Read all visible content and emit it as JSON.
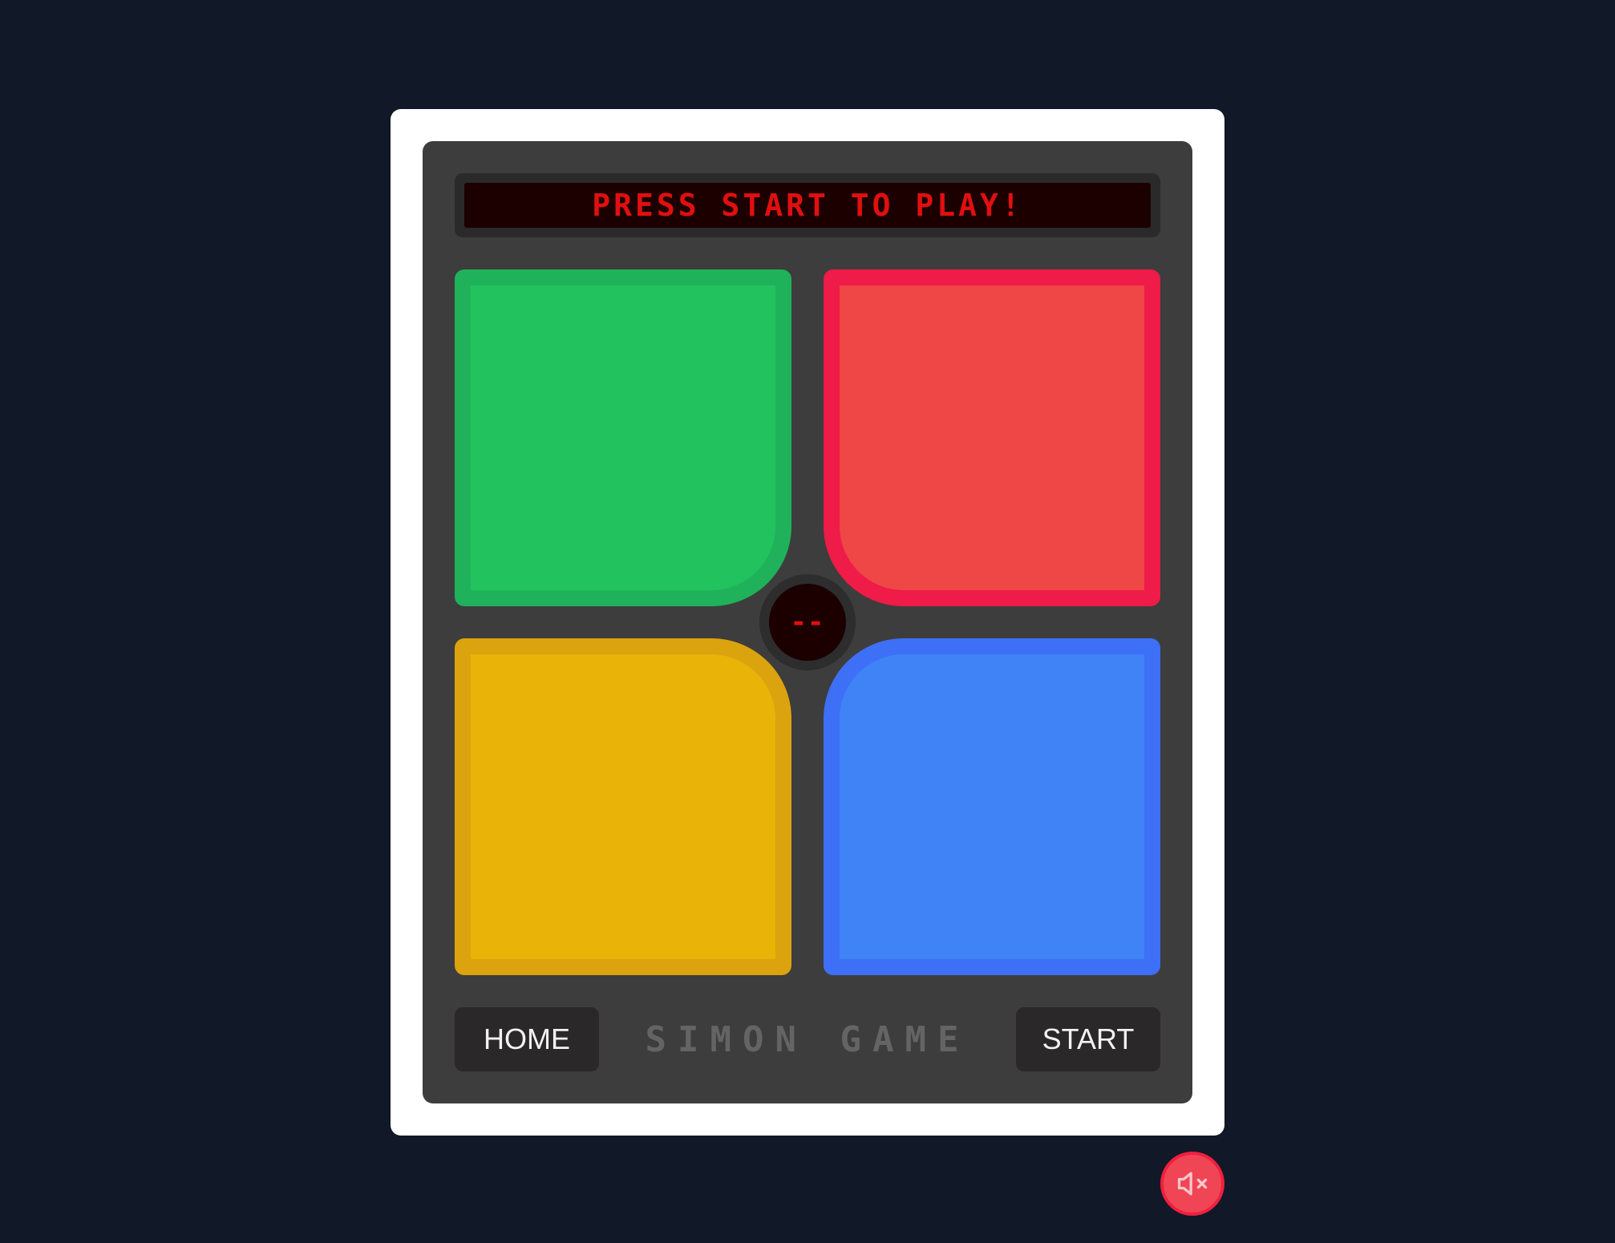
{
  "game": {
    "display_message": "PRESS START TO PLAY!",
    "counter": "--",
    "title": "SIMON GAME"
  },
  "pads": {
    "green": {
      "color": "#22c35e",
      "border": "#20b25a"
    },
    "red": {
      "color": "#ef4646",
      "border": "#ef1b48"
    },
    "yellow": {
      "color": "#eab308",
      "border": "#dba30e"
    },
    "blue": {
      "color": "#3f83f7",
      "border": "#3d70f6"
    }
  },
  "controls": {
    "home_label": "HOME",
    "start_label": "START",
    "sound_icon": "volume-muted-icon",
    "sound_muted": true
  },
  "colors": {
    "background": "#111827",
    "frame": "#ffffff",
    "console": "#3d3d3d",
    "led_text": "#e10f0f",
    "mute_button": "#f04555"
  }
}
